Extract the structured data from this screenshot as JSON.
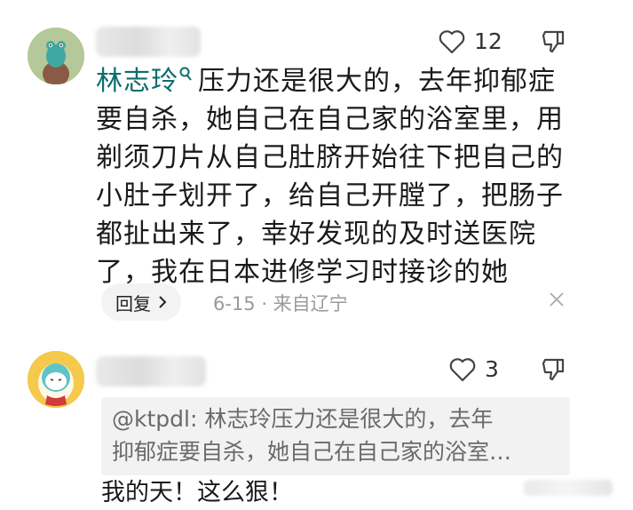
{
  "comments": [
    {
      "likes": "12",
      "author_tag": "林志玲",
      "text": "压力还是很大的，去年抑郁症要自杀，她自己在自己家的浴室里，用剃须刀片从自己肚脐开始往下把自己的小肚子划开了，给自己开膛了，把肠子都扯出来了，幸好发现的及时送医院了，我在日本进修学习时接诊的她",
      "reply_label": "回复",
      "meta": "6-15 · 来自辽宁"
    },
    {
      "likes": "3",
      "quote_line1": "@ktpdl: 林志玲压力还是很大的，去年",
      "quote_line2": "抑郁症要自杀，她自己在自己家的浴室…",
      "text": "我的天！这么狠！"
    }
  ],
  "icons": {
    "like": "heart-outline-icon",
    "dislike": "thumbs-down-icon",
    "author_badge": "search-person-icon",
    "close": "close-icon",
    "chevron": "chevron-right-icon"
  },
  "colors": {
    "author_tag": "#0d6d6d",
    "meta": "#9a9a9a",
    "quote_bg": "#f2f2f2"
  }
}
